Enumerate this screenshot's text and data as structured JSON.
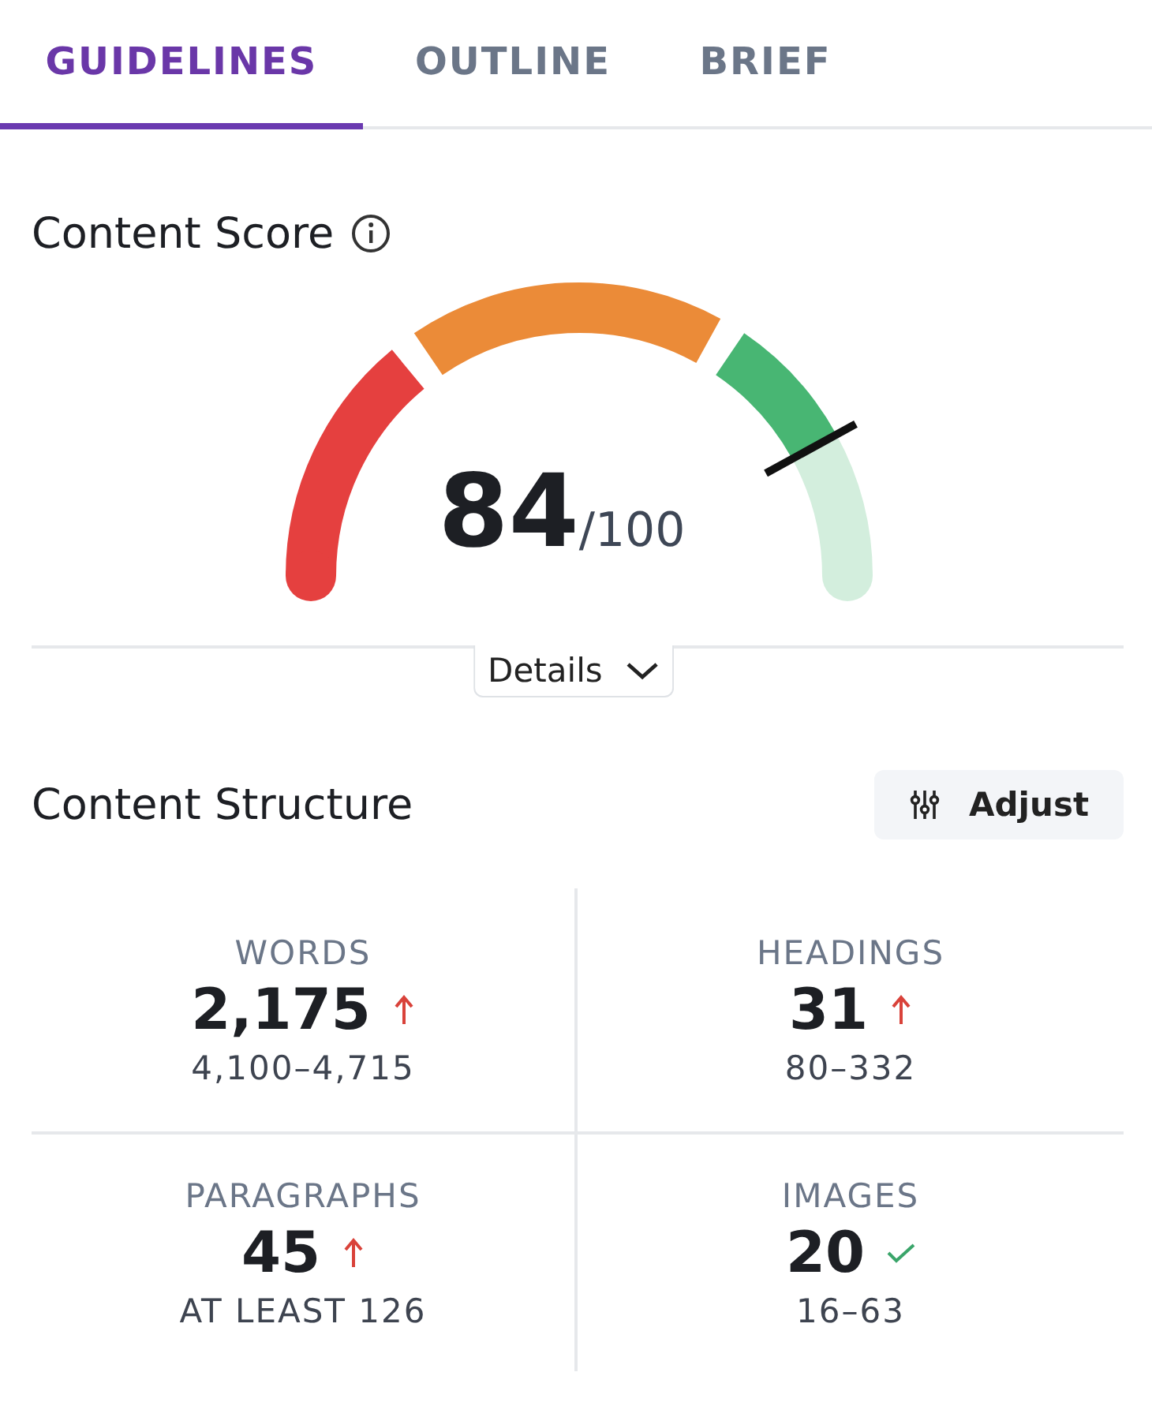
{
  "tabs": [
    {
      "label": "GUIDELINES",
      "selected": true
    },
    {
      "label": "OUTLINE",
      "selected": false
    },
    {
      "label": "BRIEF",
      "selected": false
    }
  ],
  "content_score": {
    "title": "Content Score",
    "score": "84",
    "max": "/100",
    "details_button": "Details"
  },
  "content_structure": {
    "title": "Content Structure",
    "adjust_button": "Adjust",
    "metrics": [
      {
        "label": "WORDS",
        "value": "2,175",
        "kind": "up",
        "target": "4,100–4,715"
      },
      {
        "label": "HEADINGS",
        "value": "31",
        "kind": "up",
        "target": "80–332"
      },
      {
        "label": "PARAGRAPHS",
        "value": "45",
        "kind": "up",
        "target": "AT LEAST 126"
      },
      {
        "label": "IMAGES",
        "value": "20",
        "kind": "check",
        "target": "16–63"
      }
    ]
  }
}
